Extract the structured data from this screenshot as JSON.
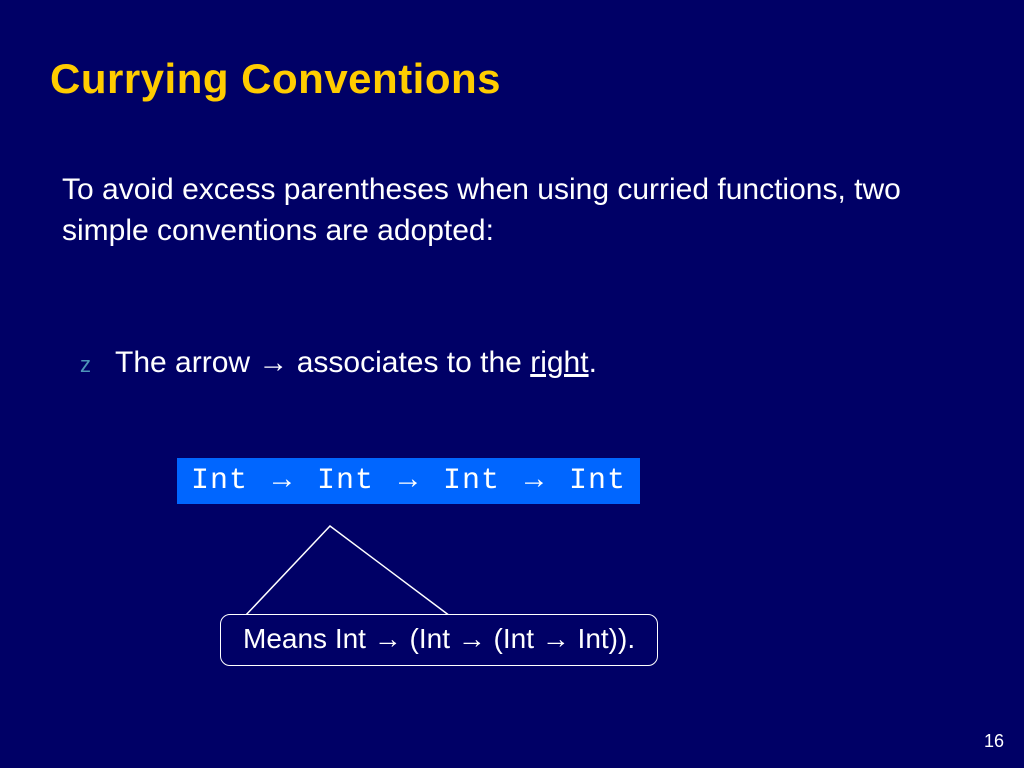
{
  "title": "Currying Conventions",
  "intro": "To avoid excess parentheses when using curried functions, two simple conventions are adopted:",
  "bullet": {
    "marker": "z",
    "pre": "The arrow ",
    "arrow": "→",
    "mid": " associates to the ",
    "underlined": "right",
    "post": "."
  },
  "code": {
    "t1": "Int ",
    "a1": "→",
    "t2": " Int ",
    "a2": "→",
    "t3": " Int ",
    "a3": "→",
    "t4": " Int"
  },
  "callout": {
    "pre": "Means Int ",
    "a1": "→",
    "t2": " (Int ",
    "a2": "→",
    "t3": " (Int ",
    "a3": "→",
    "t4": " Int))."
  },
  "page": "16"
}
